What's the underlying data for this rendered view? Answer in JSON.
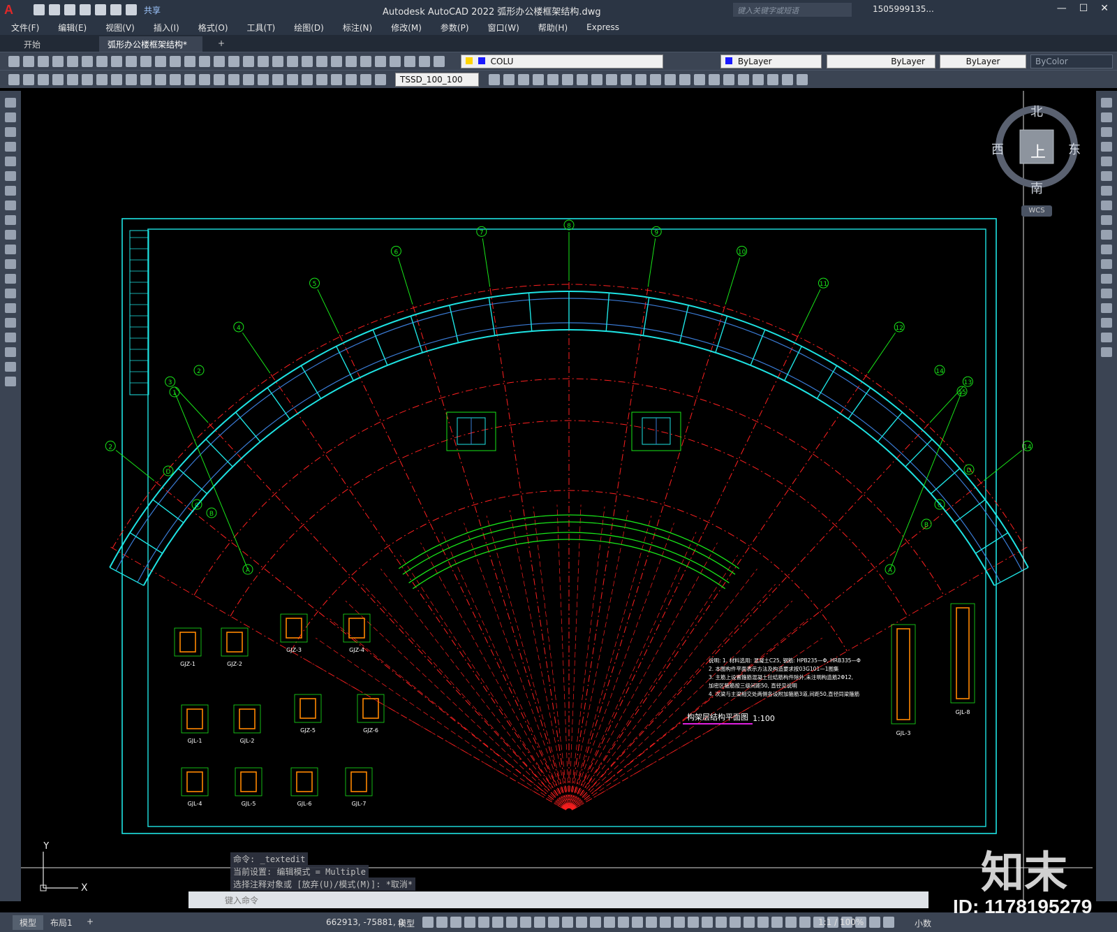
{
  "app": {
    "title": "Autodesk AutoCAD 2022    弧形办公楼框架结构.dwg",
    "logo": "A",
    "share": "共享",
    "search_placeholder": "键入关键字或短语",
    "user": "1505999135...",
    "window_controls": [
      "—",
      "☐",
      "✕"
    ]
  },
  "menu": [
    "文件(F)",
    "编辑(E)",
    "视图(V)",
    "插入(I)",
    "格式(O)",
    "工具(T)",
    "绘图(D)",
    "标注(N)",
    "修改(M)",
    "参数(P)",
    "窗口(W)",
    "帮助(H)",
    "Express"
  ],
  "tabs": {
    "start": "开始",
    "file": "弧形办公楼框架结构*",
    "close": "✕",
    "add": "+"
  },
  "toolbar1": {
    "layer": "COLU",
    "color": "ByLayer",
    "linetype": "ByLayer",
    "lineweight": "ByLayer",
    "plotstyle": "ByColor"
  },
  "toolbar2": {
    "style": "TSSD_100_100"
  },
  "viewcube": {
    "north": "北",
    "south": "南",
    "east": "东",
    "west": "西",
    "top": "上",
    "wcs": "WCS"
  },
  "drawing": {
    "plan_title": "构架层结构平面图",
    "plan_scale": "1:100",
    "grid_numbers": [
      "1",
      "2",
      "3",
      "4",
      "5",
      "6",
      "7",
      "8",
      "9",
      "10",
      "11",
      "12",
      "13",
      "14",
      "15"
    ],
    "grid_letters": [
      "A",
      "B",
      "C",
      "D"
    ],
    "notes": [
      "说明: 1. 材料选用: 混凝土C25, 钢筋: HPB235—Φ, HRB335—Φ",
      "2. 本图构件平面表示方法及构造要求按03G101—1图集",
      "3. 主筋上设置箍筋混凝土拉结筋构件除外,未注明构造筋2Φ12,",
      "加密区箍筋按三级间距50, 直径见说明",
      "4. 次梁与主梁相交处两侧各设附加箍筋3道,间距50,直径同梁箍筋"
    ],
    "detail_labels": [
      "GJZ-1",
      "GJZ-2",
      "GJZ-3",
      "GJZ-4",
      "GJL-1",
      "GJL-2",
      "GJZ-5",
      "GJZ-6",
      "GJL-4",
      "GJL-5",
      "GJL-6",
      "GJL-7",
      "GJL-3",
      "GJL-8"
    ]
  },
  "command": {
    "history": [
      "命令: _textedit",
      "当前设置: 编辑模式 = Multiple",
      "选择注释对象或 [放弃(U)/模式(M)]: *取消*"
    ],
    "placeholder": "键入命令"
  },
  "status": {
    "model_tab": "模型",
    "layout_tab": "布局1",
    "add": "+",
    "coords": "662913, -75881, 0",
    "space": "模型",
    "scale": "1:1 / 100%",
    "units": "小数"
  },
  "watermark": {
    "logo": "知末",
    "id": "ID: 1178195279"
  },
  "colors": {
    "accent": "#2b3544",
    "cyan": "#1ee3e3",
    "green": "#19e619",
    "red": "#ff2020"
  }
}
